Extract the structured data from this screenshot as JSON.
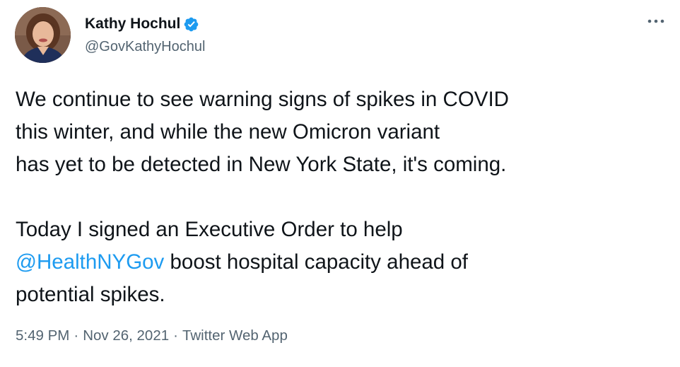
{
  "author": {
    "display_name": "Kathy Hochul",
    "handle": "@GovKathyHochul",
    "verified": true
  },
  "tweet": {
    "lines": [
      "We continue to see warning signs of spikes in COVID",
      "this winter, and while the new Omicron variant",
      "has yet to be detected in New York State, it's coming."
    ],
    "line4": "Today I signed an Executive Order to help",
    "mention": "@HealthNYGov",
    "line5_rest": " boost hospital capacity ahead of",
    "line6": "potential spikes."
  },
  "meta": {
    "time": "5:49 PM",
    "separator": "·",
    "date": "Nov 26, 2021",
    "source": "Twitter Web App"
  },
  "colors": {
    "link": "#1d9bf0",
    "verified_badge": "#1d9bf0",
    "secondary_text": "#536471"
  },
  "icons": {
    "verified": "verified-badge-icon",
    "more": "more-options-icon"
  }
}
